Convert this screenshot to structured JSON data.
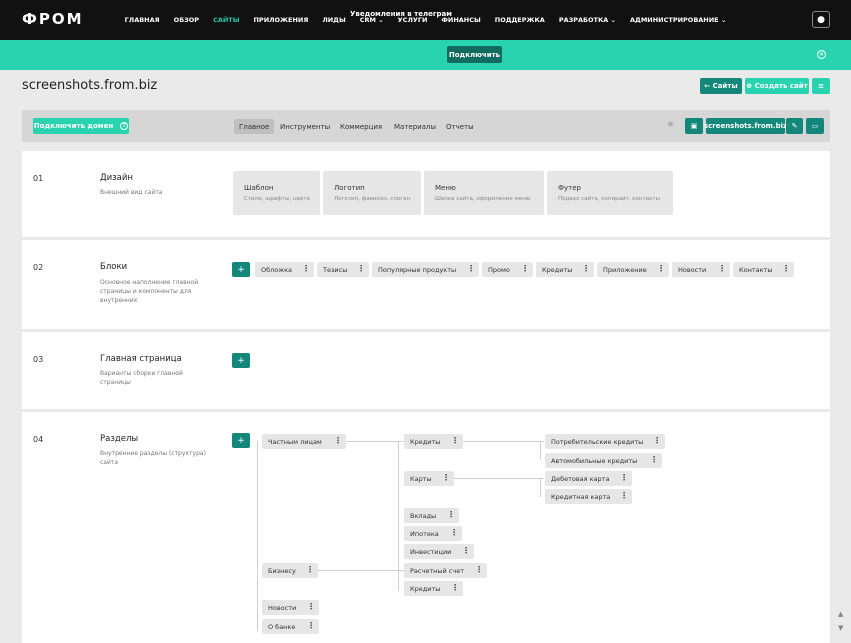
{
  "header": {
    "logo": "ФРОМ",
    "nav": [
      {
        "label": "ГЛАВНАЯ",
        "active": false
      },
      {
        "label": "ОБЗОР",
        "active": false
      },
      {
        "label": "САЙТЫ",
        "active": true
      },
      {
        "label": "ПРИЛОЖЕНИЯ",
        "active": false
      },
      {
        "label": "ЛИДЫ",
        "active": false
      },
      {
        "label": "CRM ⌄",
        "active": false
      },
      {
        "label": "УСЛУГИ",
        "active": false
      },
      {
        "label": "ФИНАНСЫ",
        "active": false
      },
      {
        "label": "ПОДДЕРЖКА",
        "active": false
      },
      {
        "label": "РАЗРАБОТКА ⌄",
        "active": false
      },
      {
        "label": "АДМИНИСТРИРОВАНИЕ ⌄",
        "active": false
      }
    ],
    "user_icon": "user-icon"
  },
  "notification": {
    "text": "Уведомления в телеграм",
    "button": "Подключить",
    "close_icon": "close-icon"
  },
  "page": {
    "title": "screenshots.from.biz",
    "sites_button": "← Сайты",
    "create_button": "⊕ Создать сайт",
    "menu_icon": "filter-icon"
  },
  "toolbar": {
    "connect_domain": "Подключить домен",
    "help_icon": "help-icon",
    "tabs": [
      "Главное",
      "Инструменты",
      "Коммерция",
      "Материалы",
      "Отчеты"
    ],
    "active_tab": "Главное",
    "site_button": "screenshots.from.biz",
    "bulb_icon": "lightbulb-icon",
    "print_icon": "printer-icon",
    "edit_icon": "pencil-icon",
    "preview_icon": "monitor-icon"
  },
  "sections": [
    {
      "num": "01",
      "title": "Дизайн",
      "desc": "Внешний вид сайта",
      "cards": [
        {
          "title": "Шаблон",
          "desc": "Стили, шрифты, цвета"
        },
        {
          "title": "Логотип",
          "desc": "Логотип, фавикон, слоган"
        },
        {
          "title": "Меню",
          "desc": "Шапка сайта, оформление меню"
        },
        {
          "title": "Футер",
          "desc": "Подвал сайта, копирайт, контакты"
        }
      ]
    },
    {
      "num": "02",
      "title": "Блоки",
      "desc": "Основное наполнение главной страницы и компоненты для внутренних",
      "chips": [
        "Обложка",
        "Тезисы",
        "Популярные продукты",
        "Промо",
        "Кредиты",
        "Приложение",
        "Новости",
        "Контакты"
      ]
    },
    {
      "num": "03",
      "title": "Главная страница",
      "desc": "Варианты сборки главной страницы"
    },
    {
      "num": "04",
      "title": "Разделы",
      "desc": "Внутренние разделы (структура) сайта",
      "tree": {
        "l1": [
          "Частным лицам",
          "Бизнесу",
          "Новости",
          "О банке"
        ],
        "l2": [
          "Кредиты",
          "Карты",
          "Вклады",
          "Ипотека",
          "Инвестиции",
          "Расчетный счет",
          "Кредиты"
        ],
        "l3": [
          "Потребительские кредиты",
          "Автомобильные кредиты",
          "Дебетовая карта",
          "Кредитная карта"
        ]
      }
    }
  ],
  "plus_label": "+",
  "dots": "⋮",
  "colors": {
    "accent": "#13877a",
    "accent_light": "#2ad3b0",
    "topbar": "#111111"
  }
}
